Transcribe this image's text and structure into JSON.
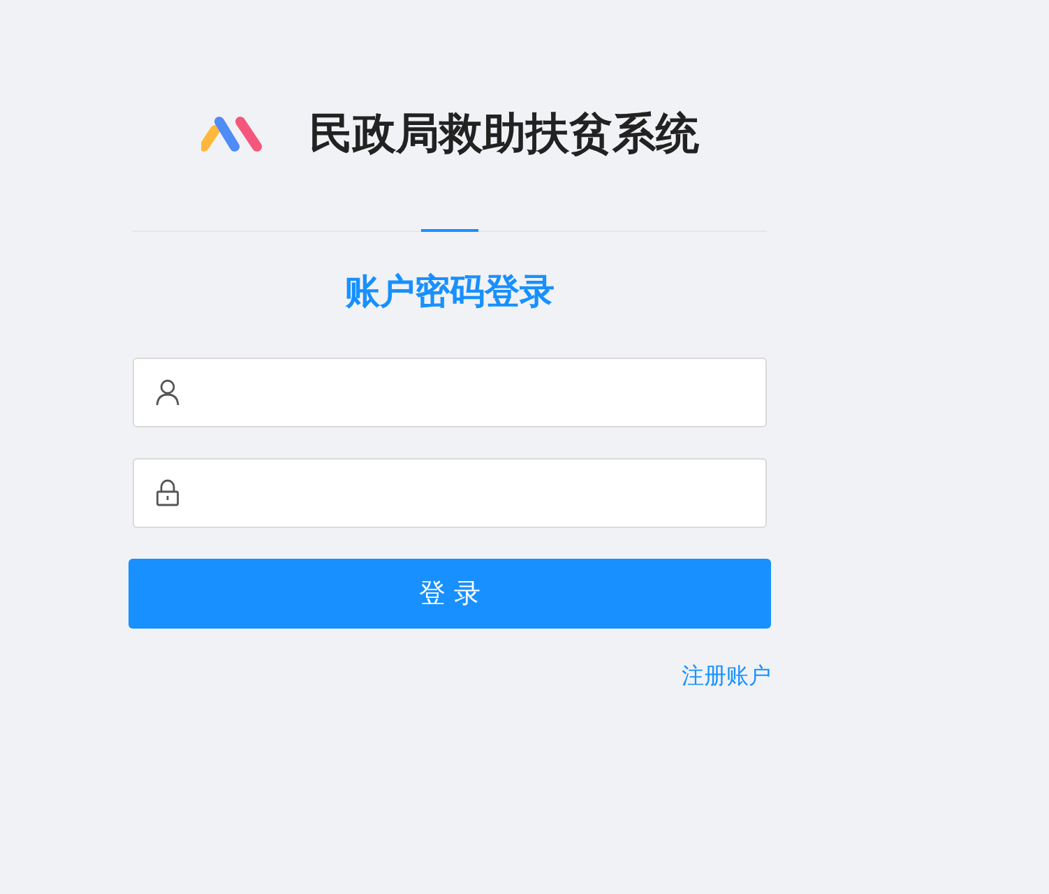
{
  "header": {
    "title": "民政局救助扶贫系统"
  },
  "tabs": [
    {
      "label": "账户密码登录",
      "selected": true
    }
  ],
  "fields": [
    {
      "kind": "user"
    },
    {
      "kind": "password"
    }
  ],
  "submit_button": "登 录",
  "register_link": "注册账户"
}
